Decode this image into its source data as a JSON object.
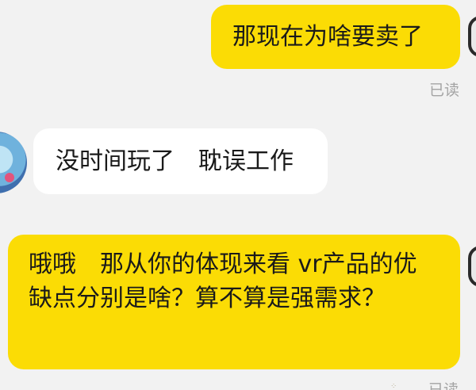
{
  "messages": [
    {
      "side": "out",
      "text": "那现在为啥要卖了",
      "status": "已读"
    },
    {
      "side": "in",
      "text": "没时间玩了　耽误工作"
    },
    {
      "side": "out",
      "text": "哦哦　那从你的体现来看 vr产品的优缺点分别是啥？算不算是强需求？",
      "status": "已读"
    }
  ],
  "colors": {
    "background": "#f2f2f2",
    "outgoing_bubble": "#fbdc05",
    "incoming_bubble": "#ffffff",
    "read_status": "#a4a4a4"
  }
}
